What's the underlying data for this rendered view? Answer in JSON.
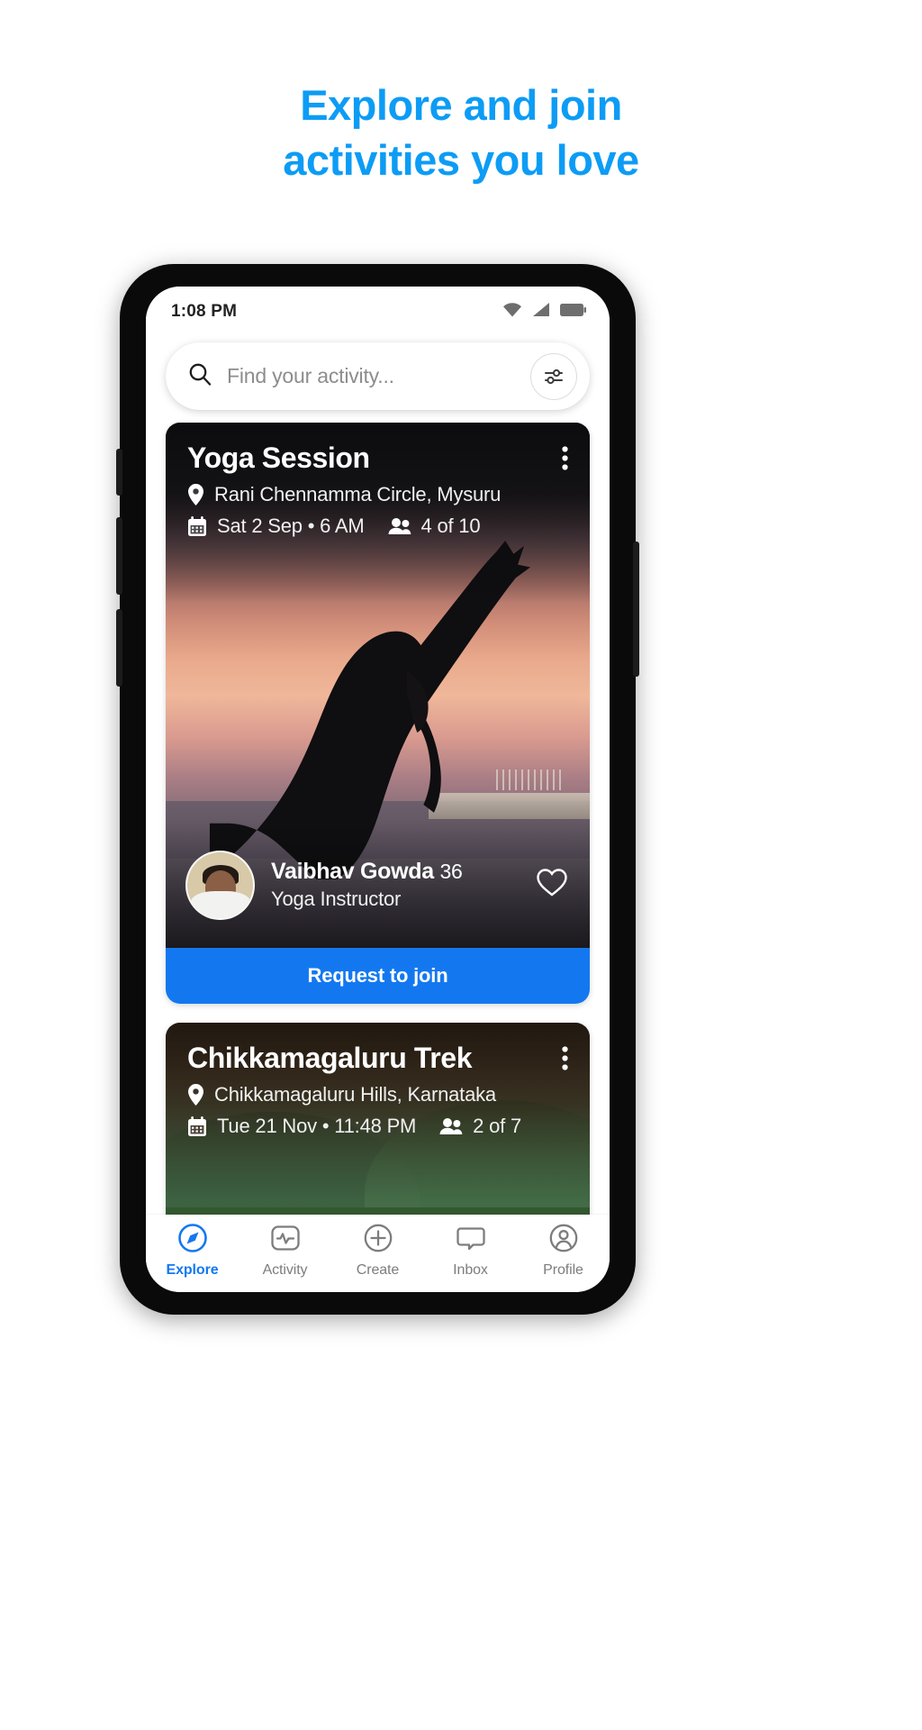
{
  "headline": {
    "line1": "Explore and join",
    "line2": "activities you love",
    "color": "#0d9cf5"
  },
  "statusbar": {
    "time": "1:08 PM",
    "icons": [
      "wifi-icon",
      "cellular-signal-icon",
      "battery-icon"
    ]
  },
  "search": {
    "placeholder": "Find your activity...",
    "value": "",
    "icon": "search-icon",
    "filter_icon": "filter-sliders-icon"
  },
  "cards": [
    {
      "title": "Yoga Session",
      "location": "Rani Chennamma Circle, Mysuru",
      "datetime": "Sat 2 Sep • 6 AM",
      "attendees": "4 of 10",
      "host_name": "Vaibhav Gowda",
      "host_age": "36",
      "host_role": "Yoga Instructor",
      "cta_label": "Request to join",
      "menu_icon": "more-vertical-icon",
      "favorite_icon": "heart-outline-icon",
      "location_icon": "map-pin-icon",
      "date_icon": "calendar-icon",
      "attendees_icon": "people-icon"
    },
    {
      "title": "Chikkamagaluru Trek",
      "location": "Chikkamagaluru Hills, Karnataka",
      "datetime": "Tue 21 Nov • 11:48 PM",
      "attendees": "2 of 7",
      "menu_icon": "more-vertical-icon",
      "location_icon": "map-pin-icon",
      "date_icon": "calendar-icon",
      "attendees_icon": "people-icon"
    }
  ],
  "bottom_nav": {
    "active_color": "#1378f0",
    "items": [
      {
        "label": "Explore",
        "icon": "compass-icon",
        "active": true
      },
      {
        "label": "Activity",
        "icon": "pulse-icon",
        "active": false
      },
      {
        "label": "Create",
        "icon": "plus-circle-icon",
        "active": false
      },
      {
        "label": "Inbox",
        "icon": "chat-bubble-icon",
        "active": false
      },
      {
        "label": "Profile",
        "icon": "user-circle-icon",
        "active": false
      }
    ]
  }
}
